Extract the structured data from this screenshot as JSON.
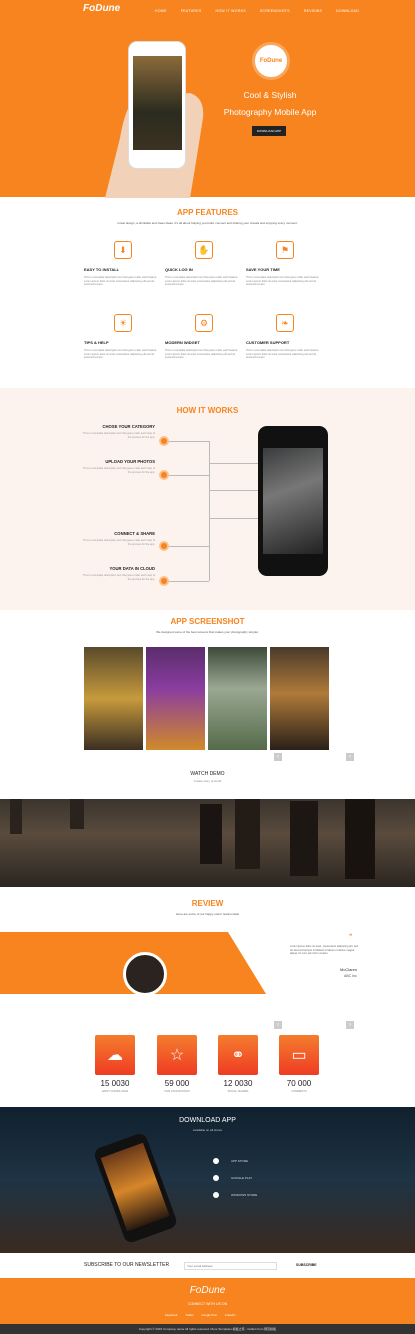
{
  "header": {
    "logo": "FoDune",
    "nav": [
      "HOME",
      "FEATURES",
      "HOW IT WORKS",
      "SCREENSHOTS",
      "REVIEWS",
      "DOWNLOAD"
    ],
    "badge": "FoDune",
    "tagline_1": "Cool & Stylish",
    "tagline_2": "Photography Mobile App",
    "download_button": "DOWNLOAD APP"
  },
  "features": {
    "title": "APP FEATURES",
    "subtitle": "Great design, a drinkable and clean ideas. It's all about helping you build, connect and sharing your visuals and enjoying every moment.",
    "items": [
      {
        "title": "EASY TO INSTALL",
        "icon": "install-icon",
        "desc": "This is a template description text that goes under each feature. Lorem ipsum dolor sit amet consectetur adipiscing elit sed do eiusmod tempor."
      },
      {
        "title": "QUICK LOG IN",
        "icon": "login-icon",
        "desc": "This is a template description text that goes under each feature. Lorem ipsum dolor sit amet consectetur adipiscing elit sed do eiusmod tempor."
      },
      {
        "title": "SAVE YOUR TIME",
        "icon": "time-icon",
        "desc": "This is a template description text that goes under each feature. Lorem ipsum dolor sit amet consectetur adipiscing elit sed do eiusmod tempor."
      },
      {
        "title": "TIPS & HELP",
        "icon": "bulb-icon",
        "desc": "This is a template description text that goes under each feature. Lorem ipsum dolor sit amet consectetur adipiscing elit sed do eiusmod tempor."
      },
      {
        "title": "MODERN WIDGET",
        "icon": "widget-icon",
        "desc": "This is a template description text that goes under each feature. Lorem ipsum dolor sit amet consectetur adipiscing elit sed do eiusmod tempor."
      },
      {
        "title": "CUSTOMER SUPPORT",
        "icon": "support-icon",
        "desc": "This is a template description text that goes under each feature. Lorem ipsum dolor sit amet consectetur adipiscing elit sed do eiusmod tempor."
      }
    ]
  },
  "how": {
    "title": "HOW IT WORKS",
    "steps": [
      {
        "title": "CHOSE YOUR CATEGORY",
        "desc": "This is a template description text that goes under each step of the process for the app."
      },
      {
        "title": "UPLOAD YOUR PHOTOS",
        "desc": "This is a template description text that goes under each step of the process for the app."
      },
      {
        "title": "CONNECT & SHARE",
        "desc": "This is a template description text that goes under each step of the process for the app."
      },
      {
        "title": "YOUR DATA IN CLOUD",
        "desc": "This is a template description text that goes under each step of the process for the app."
      }
    ]
  },
  "screens": {
    "title": "APP SCREENSHOT",
    "subtitle": "We designed some of the best screens that makes your photography simpler.",
    "demo_title": "WATCH DEMO",
    "demo_sub": "Create story of world",
    "prev": "‹",
    "next": "›"
  },
  "review": {
    "title": "REVIEW",
    "subtitle": "Here are some of our happy users' testimonials",
    "quote_mark": "❝",
    "quote": "Lorem ipsum dolor sit amet, consectetur adipiscing elit, sed do eiusmod tempor incididunt ut labore et dolore magna aliqua. Ut enim ad minim veniam.",
    "name": "McClaren",
    "company": "ABC Inc",
    "prev": "‹",
    "next": "›"
  },
  "stats": [
    {
      "num": "15 0030",
      "label": "HAPPY DOWNLOADS",
      "icon": "download-cloud-icon"
    },
    {
      "num": "59 000",
      "label": "FIVE STAR RATINGS",
      "icon": "star-icon"
    },
    {
      "num": "12 0030",
      "label": "SOCIAL SHARES",
      "icon": "share-icon"
    },
    {
      "num": "70 000",
      "label": "COMMENTS",
      "icon": "comment-icon"
    }
  ],
  "download": {
    "title": "DOWNLOAD APP",
    "subtitle": "Available on all stores",
    "stores": [
      "APP STORE",
      "GOOGLE PLAY",
      "WINDOWS STORE"
    ]
  },
  "newsletter": {
    "label": "SUBSCRIBE TO OUR NEWSLETTER",
    "placeholder": "Your email address",
    "button": "SUBSCRIBE"
  },
  "footer": {
    "logo": "FoDune",
    "connect": "CONNECT WITH US ON",
    "social": [
      "Facebook",
      "Twitter",
      "Google Plus",
      "LinkedIn"
    ],
    "copyright": "Copyright © 2015 Company name All rights reserved. More Templates 模板之家 - Collect from 网页模板"
  },
  "colors": {
    "accent": "#f7841e",
    "dark": "#222222"
  }
}
